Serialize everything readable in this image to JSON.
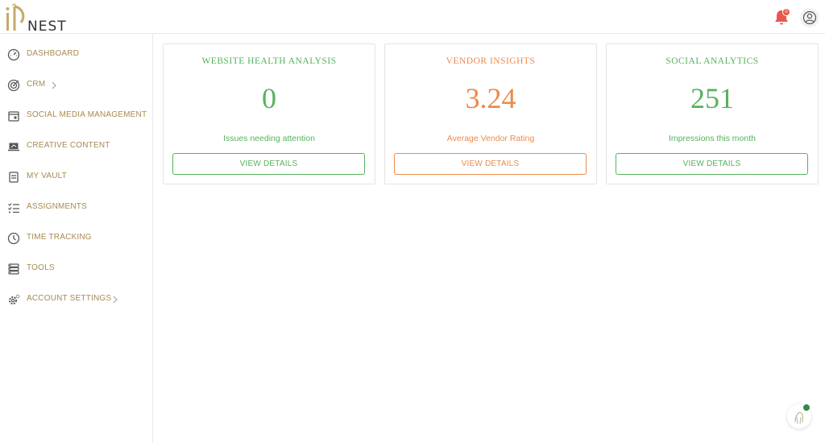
{
  "header": {
    "logo_text": "NEST",
    "notification_count": "0"
  },
  "sidebar": {
    "items": [
      {
        "label": "DASHBOARD",
        "icon": "gauge-icon"
      },
      {
        "label": "CRM",
        "icon": "target-icon",
        "has_submenu": true
      },
      {
        "label": "SOCIAL MEDIA MANAGEMENT",
        "icon": "calendar-icon"
      },
      {
        "label": "CREATIVE CONTENT",
        "icon": "laptop-icon"
      },
      {
        "label": "MY VAULT",
        "icon": "vault-icon"
      },
      {
        "label": "ASSIGNMENTS",
        "icon": "checklist-icon"
      },
      {
        "label": "TIME TRACKING",
        "icon": "clock-icon"
      },
      {
        "label": "TOOLS",
        "icon": "tools-icon"
      },
      {
        "label": "ACCOUNT SETTINGS",
        "icon": "gear-icon",
        "has_submenu": true
      }
    ]
  },
  "cards": [
    {
      "title": "WEBSITE HEALTH ANALYSIS",
      "value": "0",
      "subtitle": "Issues needing attention",
      "button": "VIEW DETAILS",
      "color": "#55b25e"
    },
    {
      "title": "VENDOR INSIGHTS",
      "value": "3.24",
      "subtitle": "Average Vendor Rating",
      "button": "VIEW DETAILS",
      "color": "#ea8b4b"
    },
    {
      "title": "SOCIAL ANALYTICS",
      "value": "251",
      "subtitle": "Impressions this month",
      "button": "VIEW DETAILS",
      "color": "#55b25e"
    }
  ],
  "colors": {
    "accent_gold": "#a68a52",
    "green": "#55b25e",
    "orange": "#ea8b4b",
    "notification_red": "#e8584b"
  }
}
